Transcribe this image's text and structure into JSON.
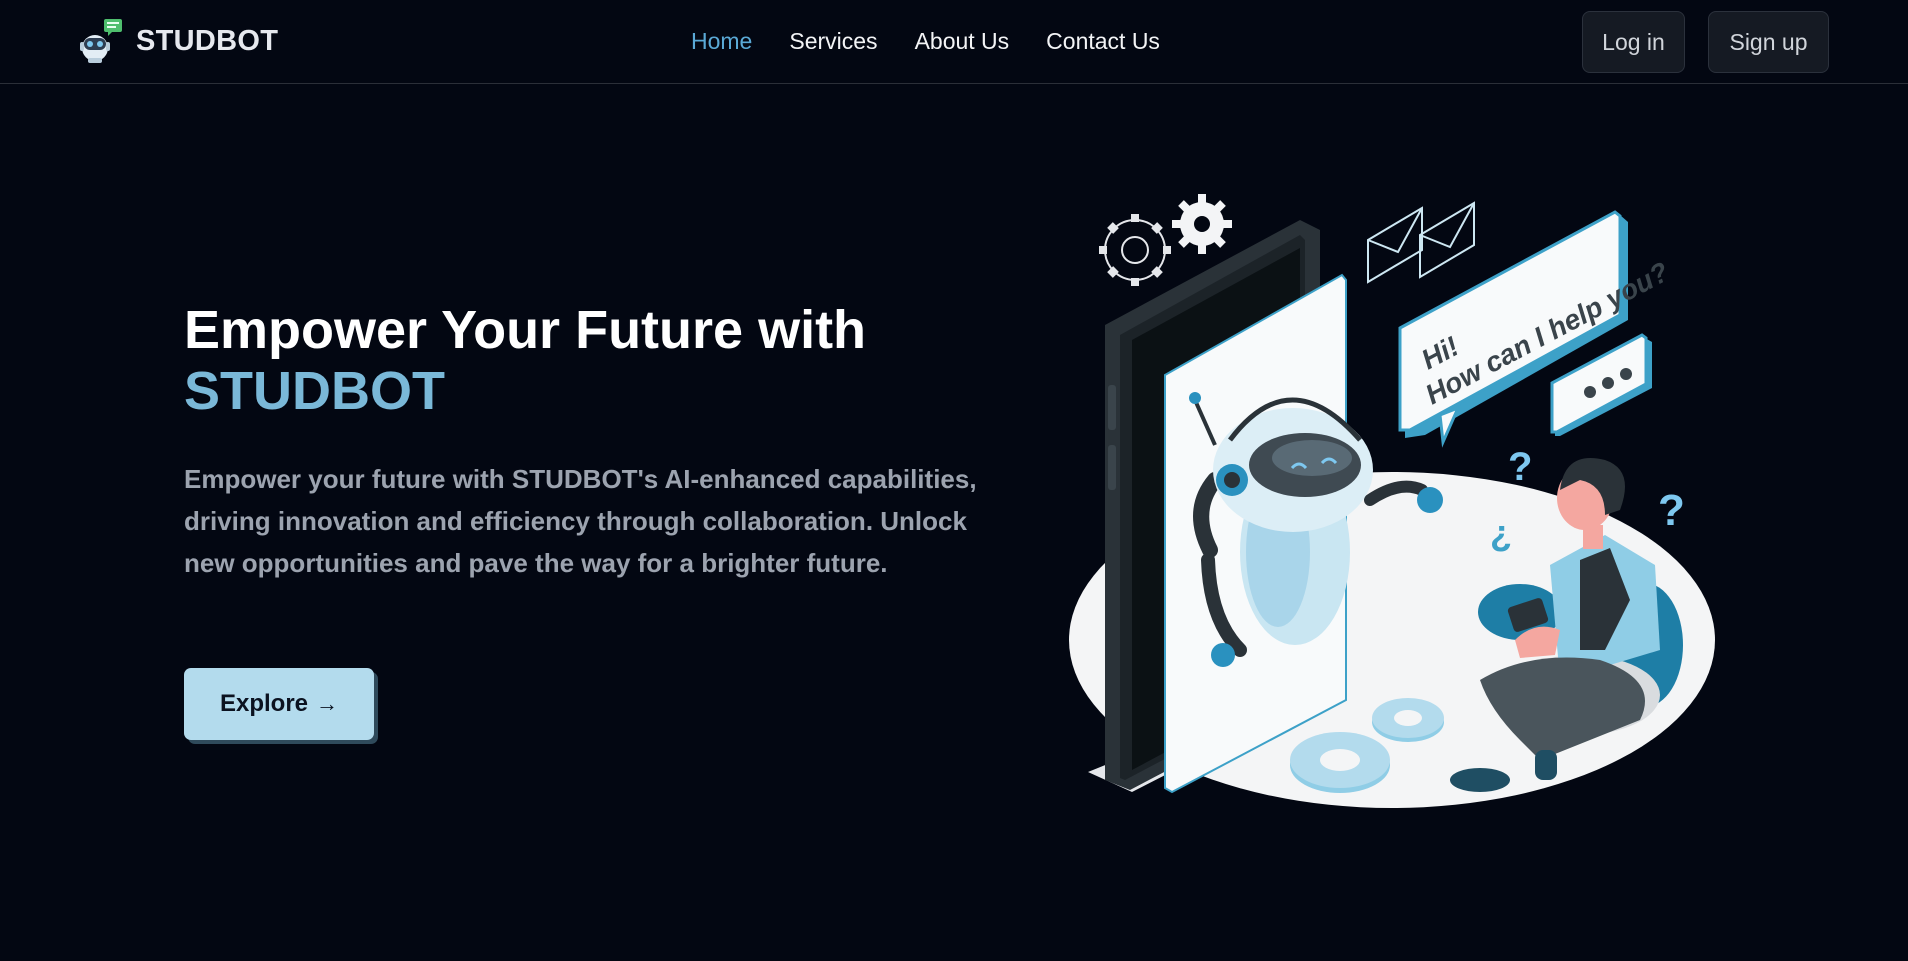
{
  "header": {
    "logo_text": "STUDBOT",
    "nav": [
      {
        "label": "Home",
        "active": true
      },
      {
        "label": "Services",
        "active": false
      },
      {
        "label": "About Us",
        "active": false
      },
      {
        "label": "Contact Us",
        "active": false
      }
    ],
    "login_label": "Log in",
    "signup_label": "Sign up"
  },
  "hero": {
    "title_line1": "Empower Your Future with",
    "title_line2": "STUDBOT",
    "description": "Empower your future with STUDBOT's AI-enhanced capabilities, driving innovation and efficiency through collaboration. Unlock new opportunities and pave the way for a brighter future.",
    "cta_label": "Explore",
    "cta_icon": "arrow-right-icon"
  },
  "illustration": {
    "speech_line1": "Hi!",
    "speech_line2": "How can I help you?"
  },
  "colors": {
    "background": "#030712",
    "accent": "#7ab8d8",
    "nav_active": "#5aa9d6",
    "cta_bg": "#b3dbed"
  }
}
